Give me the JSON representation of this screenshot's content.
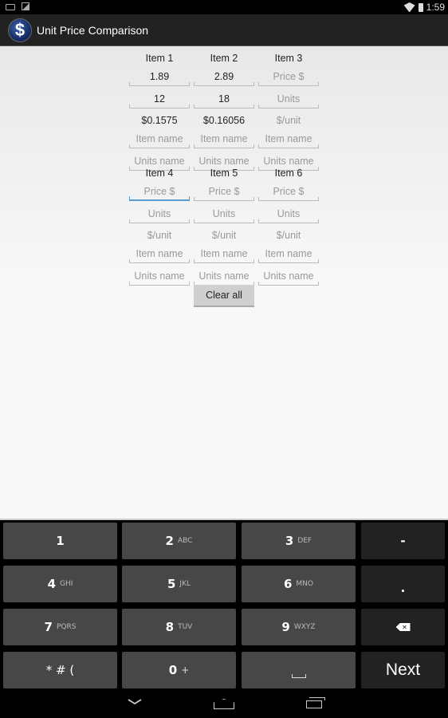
{
  "status_bar": {
    "left_icons": [
      "keyboard-icon",
      "image-icon"
    ],
    "right_icons": [
      "wifi-icon",
      "battery-icon"
    ],
    "time": "1:59"
  },
  "action_bar": {
    "app_icon": "dollar-sign-icon",
    "app_icon_glyph": "$",
    "title": "Unit Price Comparison"
  },
  "items": [
    {
      "label": "Item 1",
      "price": "1.89",
      "units": "12",
      "unit_price": "$0.1575",
      "item_name": "",
      "units_name": ""
    },
    {
      "label": "Item 2",
      "price": "2.89",
      "units": "18",
      "unit_price": "$0.16056",
      "item_name": "",
      "units_name": ""
    },
    {
      "label": "Item 3",
      "price": "",
      "units": "",
      "unit_price": "",
      "item_name": "",
      "units_name": ""
    },
    {
      "label": "Item 4",
      "price": "",
      "units": "",
      "unit_price": "",
      "item_name": "",
      "units_name": ""
    },
    {
      "label": "Item 5",
      "price": "",
      "units": "",
      "unit_price": "",
      "item_name": "",
      "units_name": ""
    },
    {
      "label": "Item 6",
      "price": "",
      "units": "",
      "unit_price": "",
      "item_name": "",
      "units_name": ""
    }
  ],
  "placeholders": {
    "price": "Price $",
    "units": "Units",
    "unit_price": "$/unit",
    "item_name": "Item name",
    "units_name": "Units name"
  },
  "focused_field": "Item 4 price",
  "clear_all_label": "Clear all",
  "keyboard": {
    "keys": [
      {
        "main": "1",
        "sub": ""
      },
      {
        "main": "2",
        "sub": "ABC"
      },
      {
        "main": "3",
        "sub": "DEF"
      },
      {
        "main": "-",
        "sub": ""
      },
      {
        "main": "4",
        "sub": "GHI"
      },
      {
        "main": "5",
        "sub": "JKL"
      },
      {
        "main": "6",
        "sub": "MNO"
      },
      {
        "main": ".",
        "sub": ""
      },
      {
        "main": "7",
        "sub": "PQRS"
      },
      {
        "main": "8",
        "sub": "TUV"
      },
      {
        "main": "9",
        "sub": "WXYZ"
      },
      {
        "main": "backspace-icon",
        "sub": ""
      },
      {
        "main": "* # (",
        "sub": ""
      },
      {
        "main": "0",
        "sub": "+"
      },
      {
        "main": "space-icon",
        "sub": ""
      },
      {
        "main": "Next",
        "sub": ""
      }
    ],
    "backspace_glyph": "✕"
  },
  "nav_bar": {
    "buttons": [
      "back-icon",
      "home-icon",
      "recent-apps-icon"
    ]
  },
  "colors": {
    "action_bar_bg": "#222222",
    "focus_underline": "#5a9bd0",
    "key_bg": "#474747",
    "key_dark_bg": "#222222"
  }
}
